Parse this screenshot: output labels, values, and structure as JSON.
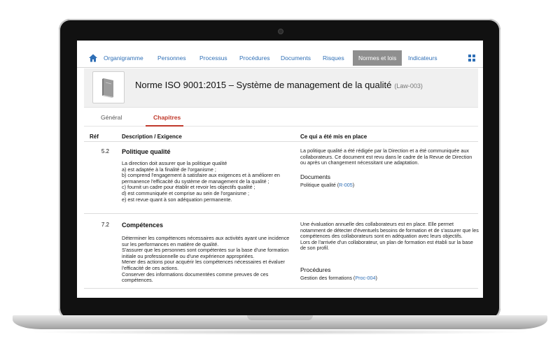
{
  "nav": {
    "items": [
      "Organigramme",
      "Personnes",
      "Processus",
      "Procédures",
      "Documents",
      "Risques",
      "Normes et lois",
      "Indicateurs"
    ],
    "active": "Normes et lois"
  },
  "header": {
    "title": "Norme ISO 9001:2015 – Système de management de la qualité",
    "code": "(Law-003)"
  },
  "tabs": {
    "general": "Général",
    "chapitres": "Chapitres"
  },
  "table": {
    "col_ref": "Réf",
    "col_desc": "Description / Exigence",
    "col_done": "Ce qui a été mis en place",
    "rows": [
      {
        "ref": "5.2",
        "title": "Politique qualité",
        "description": "La direction doit assurer que la politique qualité\na) est adaptée à la finalité de l'organisme ;\nb) comprend l'engagement à satisfaire aux exigences et à améliorer en permanence l'efficacité du système de management de la qualité ;\nc) fournit un cadre pour établir et revoir les objectifs qualité ;\nd) est communiquée et comprise au sein de l'organisme ;\ne) est revue quant à son adéquation permanente.",
        "done": "La politique qualité a été rédigée par la Direction et a été communiquée aux collaborateurs. Ce document est revu dans le cadre de la Revue de Direction ou après un changement nécessitant une adaptation.",
        "link_section": "Documents",
        "link_prefix": "Politique qualité (",
        "link_code": "R-005",
        "link_suffix": ")"
      },
      {
        "ref": "7.2",
        "title": "Compétences",
        "description": "Déterminer les compétences nécessaires aux activités ayant une incidence sur les performances en matière de qualité.\nS'assurer que les personnes sont compétentes sur la base d'une formation initiale ou professionnelle ou d'une expérience appropriées.\nMener des actions pour acquérir les compétences nécessaires et évaluer l'efficacité de ces actions.\nConserver des informations documentées comme preuves de ces compétences.",
        "done": "Une évaluation annuelle des collaborateurs est en place. Elle permet notamment de détecter d'éventuels besoins de formation et de s'assurer que les compétences des collaborateurs sont en adéquation avec leurs objectifs.\nLors de l'arrivée d'un collaborateur, un plan de formation est établi sur la base de son profil.",
        "link_section": "Procédures",
        "link_prefix": "Gestion des formations (",
        "link_code": "Proc-004",
        "link_suffix": ")"
      }
    ]
  },
  "colors": {
    "link": "#2f6fb6",
    "active_tab": "#c0392b",
    "active_nav_bg": "#8f8f8f"
  },
  "icons": {
    "home": "home-icon",
    "grid": "grid-icon",
    "document": "book-icon"
  }
}
